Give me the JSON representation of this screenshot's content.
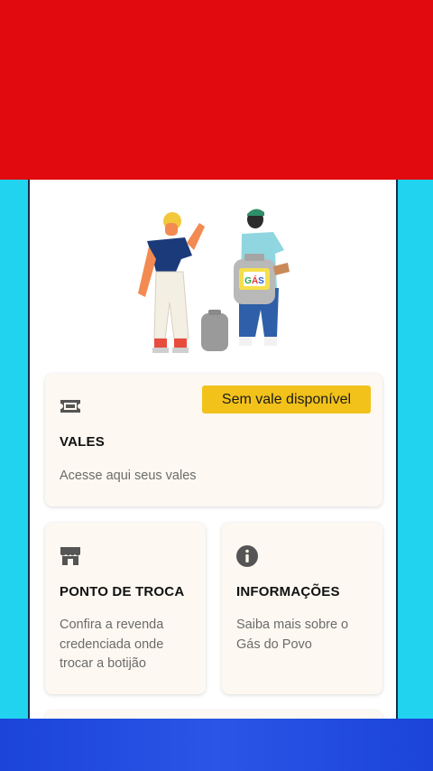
{
  "vales_card": {
    "badge": "Sem vale disponível",
    "title": "VALES",
    "description": "Acesse aqui seus vales",
    "icon": "ticket-icon"
  },
  "ponto_card": {
    "title": "PONTO DE TROCA",
    "description": "Confira a revenda credenciada onde trocar a botijão",
    "icon": "store-icon"
  },
  "info_card": {
    "title": "INFORMAÇÕES",
    "description": "Saiba mais sobre o Gás do Povo",
    "icon": "info-icon"
  },
  "illustration": {
    "cylinder_label": "GÁS"
  },
  "colors": {
    "top_band": "#e00a0f",
    "side": "#21d3ef",
    "bottom_band": "#1b44d8",
    "badge": "#f2c21b"
  }
}
